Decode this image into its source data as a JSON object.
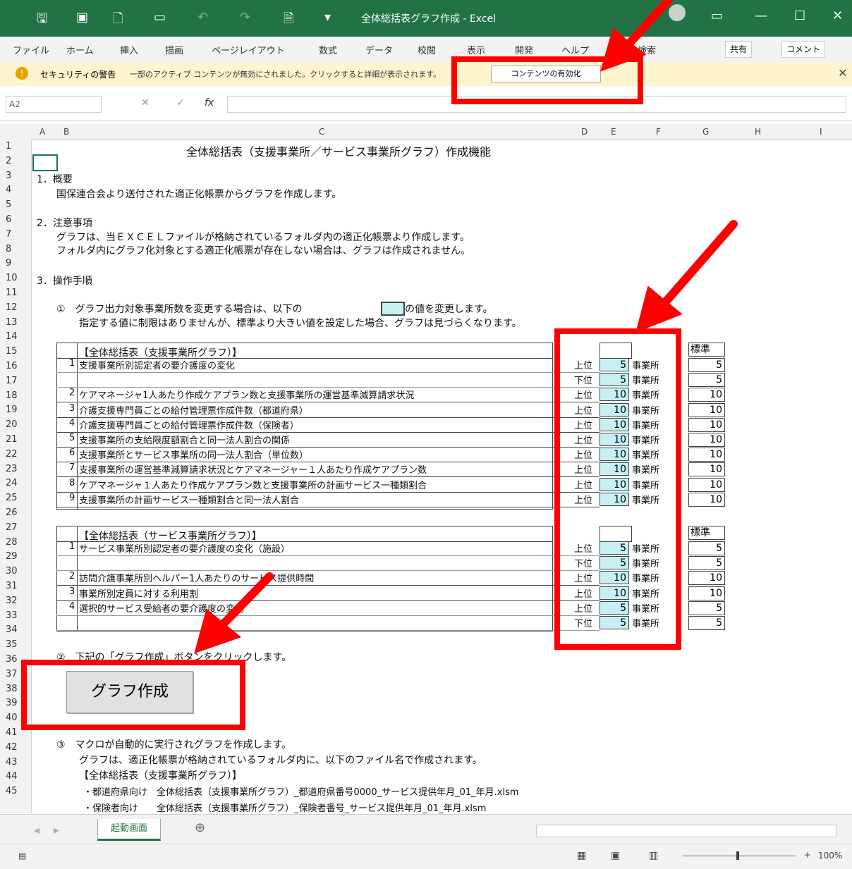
{
  "titlebar": {
    "title": "全体総括表グラフ作成 - Excel",
    "icons": [
      "save-icon",
      "new-icon",
      "open-icon",
      "undo-icon",
      "redo-icon",
      "user-icon"
    ]
  },
  "ribbon": {
    "tabs": [
      "ファイル",
      "ホーム",
      "挿入",
      "描画",
      "ページレイアウト",
      "数式",
      "データ",
      "校閲",
      "表示",
      "開発",
      "ヘルプ",
      "検索"
    ],
    "share": "共有",
    "comment": "コメント"
  },
  "security": {
    "title": "セキュリティの警告",
    "message": "一部のアクティブ コンテンツが無効にされました。クリックすると詳細が表示されます。",
    "button": "コンテンツの有効化"
  },
  "formula": {
    "namebox": "A2",
    "fx": "fx"
  },
  "columns": [
    "A",
    "B",
    "C",
    "D",
    "E",
    "F",
    "G",
    "H",
    "I"
  ],
  "rows": [
    "1",
    "2",
    "3",
    "4",
    "5",
    "6",
    "7",
    "8",
    "9",
    "10",
    "11",
    "12",
    "13",
    "14",
    "15",
    "16",
    "17",
    "18",
    "19",
    "20",
    "21",
    "22",
    "23",
    "24",
    "25",
    "26",
    "27",
    "28",
    "29",
    "30",
    "31",
    "32",
    "33",
    "34",
    "35",
    "36",
    "37",
    "38",
    "39",
    "40",
    "41",
    "42",
    "43",
    "44",
    "45"
  ],
  "doc": {
    "title": "全体総括表（支援事業所／サービス事業所グラフ）作成機能",
    "s1_head": "1．概要",
    "s1_body": "国保連合会より送付された適正化帳票からグラフを作成します。",
    "s2_head": "2．注意事項",
    "s2_l1": "グラフは、当ＥＸＣＥＬファイルが格納されているフォルダ内の適正化帳票より作成します。",
    "s2_l2": "フォルダ内にグラフ化対象とする適正化帳票が存在しない場合は、グラフは作成されません。",
    "s3_head": "3．操作手順",
    "step1_a": "①　グラフ出力対象事業所数を変更する場合は、以下の",
    "step1_b": "の値を変更します。",
    "step1_c": "指定する値に制限はありませんが、標準より大きい値を設定した場合、グラフは見づらくなります。",
    "step2": "②　下記の「グラフ作成」ボタンをクリックします。",
    "step3": "③　マクロが自動的に実行されグラフを作成します。",
    "step3_l1": "グラフは、適正化帳票が格納されているフォルダ内に、以下のファイル名で作成されます。",
    "step3_l2": "【全体総括表（支援事業所グラフ）】",
    "step3_l3": "・都道府県向け　全体総括表（支援事業所グラフ）_都道府県番号0000_サービス提供年月_01_年月.xlsm",
    "step3_l4": "・保険者向け　　全体総括表（支援事業所グラフ）_保険者番号_サービス提供年月_01_年月.xlsm"
  },
  "table1": {
    "header": "【全体総括表（支援事業所グラフ）】",
    "std_label": "標準",
    "rows": [
      {
        "num": "1",
        "text": "支援事業所別認定者の要介護度の変化",
        "pos": "上位",
        "val": "5",
        "unit": "事業所",
        "std": "5"
      },
      {
        "num": "",
        "text": "",
        "pos": "下位",
        "val": "5",
        "unit": "事業所",
        "std": "5"
      },
      {
        "num": "2",
        "text": "ケアマネージャ1人あたり作成ケアプラン数と支援事業所の運営基準減算請求状況",
        "pos": "上位",
        "val": "10",
        "unit": "事業所",
        "std": "10"
      },
      {
        "num": "3",
        "text": "介護支援専門員ごとの給付管理票作成件数（都道府県）",
        "pos": "上位",
        "val": "10",
        "unit": "事業所",
        "std": "10"
      },
      {
        "num": "4",
        "text": "介護支援専門員ごとの給付管理票作成件数（保険者）",
        "pos": "上位",
        "val": "10",
        "unit": "事業所",
        "std": "10"
      },
      {
        "num": "5",
        "text": "支援事業所の支給限度額割合と同一法人割合の関係",
        "pos": "上位",
        "val": "10",
        "unit": "事業所",
        "std": "10"
      },
      {
        "num": "6",
        "text": "支援事業所とサービス事業所の同一法人割合（単位数）",
        "pos": "上位",
        "val": "10",
        "unit": "事業所",
        "std": "10"
      },
      {
        "num": "7",
        "text": "支援事業所の運営基準減算請求状況とケアマネージャー１人あたり作成ケアプラン数",
        "pos": "上位",
        "val": "10",
        "unit": "事業所",
        "std": "10"
      },
      {
        "num": "8",
        "text": "ケアマネージャ１人あたり作成ケアプラン数と支援事業所の計画サービス一種類割合",
        "pos": "上位",
        "val": "10",
        "unit": "事業所",
        "std": "10"
      },
      {
        "num": "9",
        "text": "支援事業所の計画サービス一種類割合と同一法人割合",
        "pos": "上位",
        "val": "10",
        "unit": "事業所",
        "std": "10"
      }
    ]
  },
  "table2": {
    "header": "【全体総括表（サービス事業所グラフ）】",
    "std_label": "標準",
    "rows": [
      {
        "num": "1",
        "text": "サービス事業所別認定者の要介護度の変化（施設）",
        "pos": "上位",
        "val": "5",
        "unit": "事業所",
        "std": "5"
      },
      {
        "num": "",
        "text": "",
        "pos": "下位",
        "val": "5",
        "unit": "事業所",
        "std": "5"
      },
      {
        "num": "2",
        "text": "訪問介護事業所別ヘルパー1人あたりのサービス提供時間",
        "pos": "上位",
        "val": "10",
        "unit": "事業所",
        "std": "10"
      },
      {
        "num": "3",
        "text": "事業所別定員に対する利用割",
        "pos": "上位",
        "val": "10",
        "unit": "事業所",
        "std": "10"
      },
      {
        "num": "4",
        "text": "選択的サービス受給者の要介護度の変化",
        "pos": "上位",
        "val": "5",
        "unit": "事業所",
        "std": "5"
      },
      {
        "num": "",
        "text": "",
        "pos": "下位",
        "val": "5",
        "unit": "事業所",
        "std": "5"
      }
    ]
  },
  "graph_button": "グラフ作成",
  "sheet_tab": "起動画面",
  "status": {
    "zoom": "100%"
  },
  "annotation_color": "#ff0000"
}
